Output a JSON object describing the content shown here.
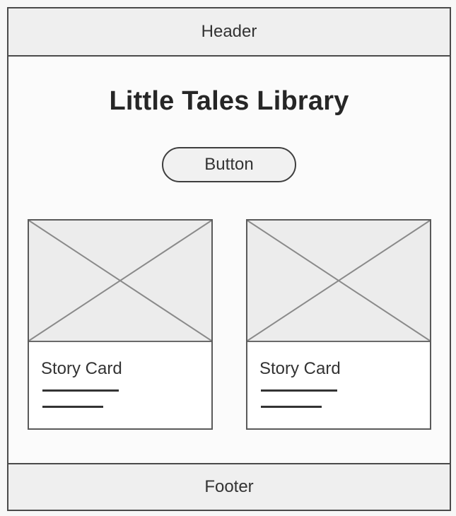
{
  "header": {
    "label": "Header"
  },
  "main": {
    "title": "Little Tales Library",
    "button_label": "Button"
  },
  "cards": [
    {
      "title": "Story Card"
    },
    {
      "title": "Story Card"
    }
  ],
  "footer": {
    "label": "Footer"
  }
}
